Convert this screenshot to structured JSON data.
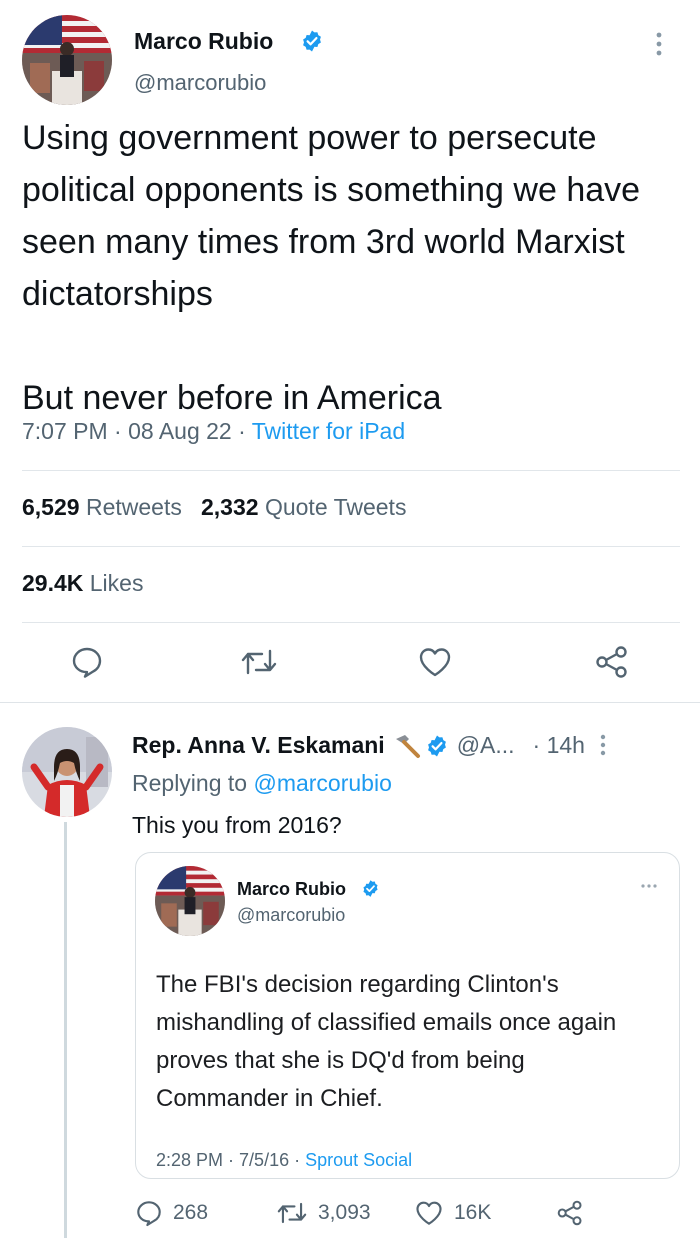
{
  "main_tweet": {
    "name": "Marco Rubio",
    "handle": "@marcorubio",
    "text": "Using government power to persecute political opponents is something we have seen many times from 3rd world Marxist dictatorships\n\nBut never before in America",
    "time": "7:07 PM",
    "dot1": " · ",
    "date": "08 Aug 22",
    "dot2": " · ",
    "source": "Twitter for iPad",
    "retweets_count": "6,529",
    "retweets_label": "Retweets",
    "quotes_count": "2,332",
    "quotes_label": "Quote Tweets",
    "likes_count": "29.4K",
    "likes_label": "Likes"
  },
  "reply": {
    "name": "Rep. Anna V. Eskamani",
    "handle": "@A...",
    "age": "· 14h",
    "replying_prefix": "Replying to ",
    "replying_handle": "@marcorubio",
    "text": "This you from 2016?",
    "stats": {
      "replies": "268",
      "retweets": "3,093",
      "likes": "16K"
    }
  },
  "quoted_tweet": {
    "name": "Marco Rubio",
    "handle": "@marcorubio",
    "text": "The FBI's decision regarding Clinton's mishandling of classified emails  once again proves that she is DQ'd from being Commander in Chief.",
    "time": "2:28 PM",
    "dot1": " · ",
    "date": "7/5/16",
    "dot2": " · ",
    "source": "Sprout Social"
  },
  "colors": {
    "accent": "#1d9bf0",
    "text": "#0f1419",
    "muted": "#536471",
    "divider": "#e1e6ea"
  },
  "icons": {
    "verified": "verified-badge-icon",
    "more": "more-vertical-icon",
    "reply": "reply-icon",
    "retweet": "retweet-icon",
    "like": "heart-icon",
    "share": "share-icon",
    "hammer": "hammer-icon"
  }
}
